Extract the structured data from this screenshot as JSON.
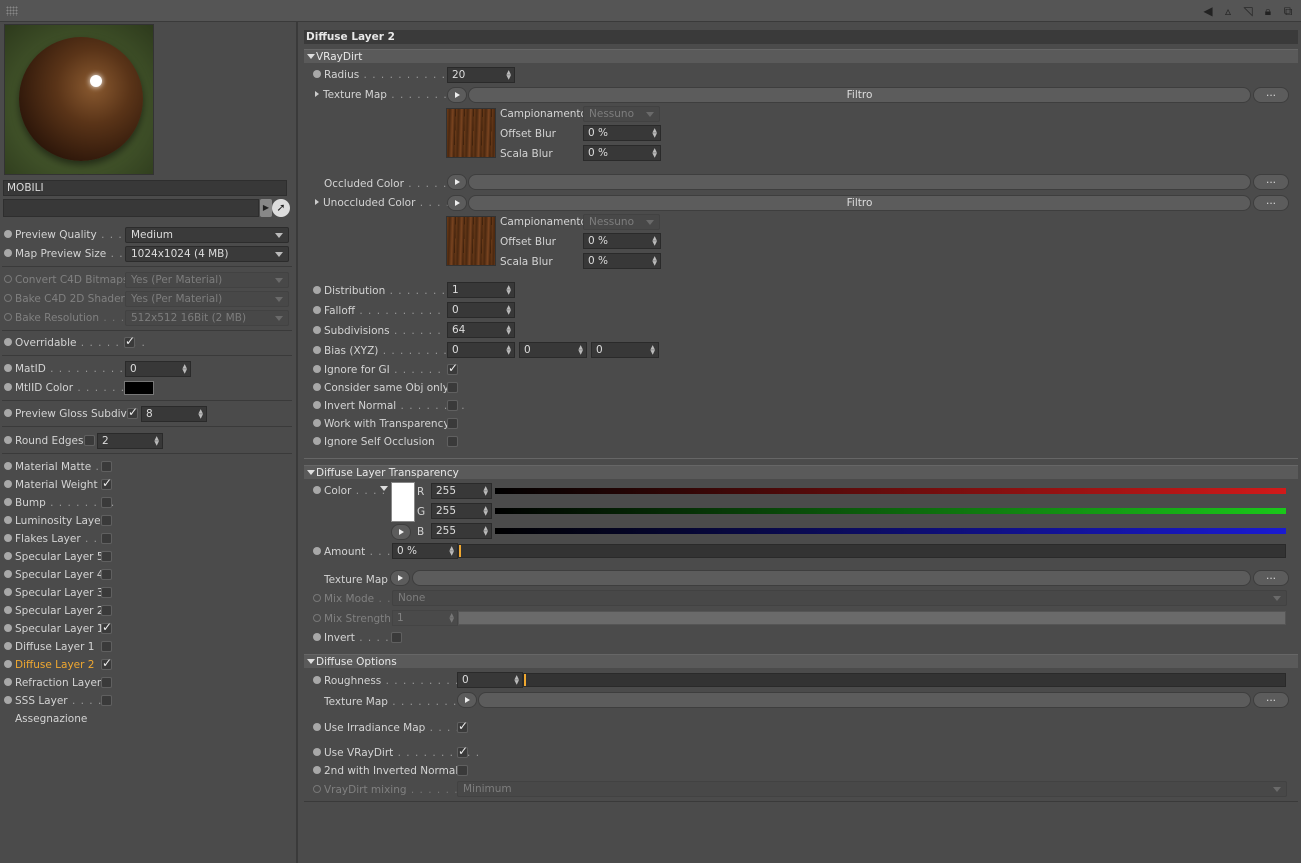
{
  "material": {
    "name": "MOBILI"
  },
  "left": {
    "preview_quality": {
      "label": "Preview Quality",
      "value": "Medium"
    },
    "map_preview_size": {
      "label": "Map Preview Size",
      "value": "1024x1024 (4 MB)"
    },
    "convert_c4d_bitmaps": {
      "label": "Convert C4D Bitmaps",
      "value": "Yes (Per Material)"
    },
    "bake_c4d_2d_shaders": {
      "label": "Bake C4D 2D Shaders",
      "value": "Yes (Per Material)"
    },
    "bake_resolution": {
      "label": "Bake Resolution",
      "value": "512x512   16Bit   (2 MB)"
    },
    "overridable": {
      "label": "Overridable"
    },
    "matid": {
      "label": "MatID",
      "value": "0"
    },
    "mtlid_color": {
      "label": "MtlID Color"
    },
    "preview_gloss_subdivs": {
      "label": "Preview Gloss Subdivs",
      "value": "8"
    },
    "round_edges": {
      "label": "Round Edges",
      "value": "2"
    },
    "layers": [
      {
        "label": "Material Matte",
        "checked": false
      },
      {
        "label": "Material Weight",
        "checked": true
      },
      {
        "label": "Bump",
        "checked": false
      },
      {
        "label": "Luminosity Layer",
        "checked": false
      },
      {
        "label": "Flakes Layer",
        "checked": false
      },
      {
        "label": "Specular Layer 5",
        "checked": false
      },
      {
        "label": "Specular Layer 4",
        "checked": false
      },
      {
        "label": "Specular Layer 3",
        "checked": false
      },
      {
        "label": "Specular Layer 2",
        "checked": false
      },
      {
        "label": "Specular Layer 1",
        "checked": true
      },
      {
        "label": "Diffuse Layer 1",
        "checked": false
      },
      {
        "label": "Diffuse Layer 2",
        "checked": true
      },
      {
        "label": "Refraction Layer",
        "checked": false
      },
      {
        "label": "SSS Layer",
        "checked": false
      }
    ],
    "assegnazione": "Assegnazione"
  },
  "right": {
    "title": "Diffuse Layer 2",
    "vraydirt": {
      "section": "VRayDirt",
      "radius": {
        "label": "Radius",
        "value": "20"
      },
      "texture_map": {
        "label": "Texture Map",
        "button": "Filtro"
      },
      "sub1": {
        "campionamento": {
          "label": "Campionamento",
          "value": "Nessuno"
        },
        "offset_blur": {
          "label": "Offset Blur",
          "value": "0 %"
        },
        "scala_blur": {
          "label": "Scala Blur",
          "value": "0 %"
        }
      },
      "occluded_color": {
        "label": "Occluded Color"
      },
      "unoccluded_color": {
        "label": "Unoccluded Color",
        "button": "Filtro"
      },
      "sub2": {
        "campionamento": {
          "label": "Campionamento",
          "value": "Nessuno"
        },
        "offset_blur": {
          "label": "Offset Blur",
          "value": "0 %"
        },
        "scala_blur": {
          "label": "Scala Blur",
          "value": "0 %"
        }
      },
      "distribution": {
        "label": "Distribution",
        "value": "1"
      },
      "falloff": {
        "label": "Falloff",
        "value": "0"
      },
      "subdivisions": {
        "label": "Subdivisions",
        "value": "64"
      },
      "bias": {
        "label": "Bias (XYZ)",
        "x": "0",
        "y": "0",
        "z": "0"
      },
      "ignore_for_gi": {
        "label": "Ignore for GI"
      },
      "consider_same_obj": {
        "label": "Consider same Obj only"
      },
      "invert_normal": {
        "label": "Invert Normal"
      },
      "work_with_transparency": {
        "label": "Work with Transparency"
      },
      "ignore_self_occlusion": {
        "label": "Ignore Self Occlusion"
      },
      "more_label": "..."
    },
    "transparency": {
      "section": "Diffuse Layer Transparency",
      "color": {
        "label": "Color",
        "r_label": "R",
        "g_label": "G",
        "b_label": "B",
        "r": "255",
        "g": "255",
        "b": "255"
      },
      "amount": {
        "label": "Amount",
        "value": "0 %"
      },
      "texture_map": {
        "label": "Texture Map"
      },
      "mix_mode": {
        "label": "Mix Mode",
        "value": "None"
      },
      "mix_strength": {
        "label": "Mix Strength",
        "value": "1"
      },
      "invert": {
        "label": "Invert"
      }
    },
    "options": {
      "section": "Diffuse Options",
      "roughness": {
        "label": "Roughness",
        "value": "0"
      },
      "texture_map": {
        "label": "Texture Map"
      },
      "use_irradiance_map": {
        "label": "Use Irradiance Map"
      },
      "use_vraydirt": {
        "label": "Use VRayDirt"
      },
      "second_inverted": {
        "label": "2nd with Inverted Normals"
      },
      "vraydirt_mixing": {
        "label": "VrayDirt mixing",
        "value": "Minimum"
      }
    }
  }
}
